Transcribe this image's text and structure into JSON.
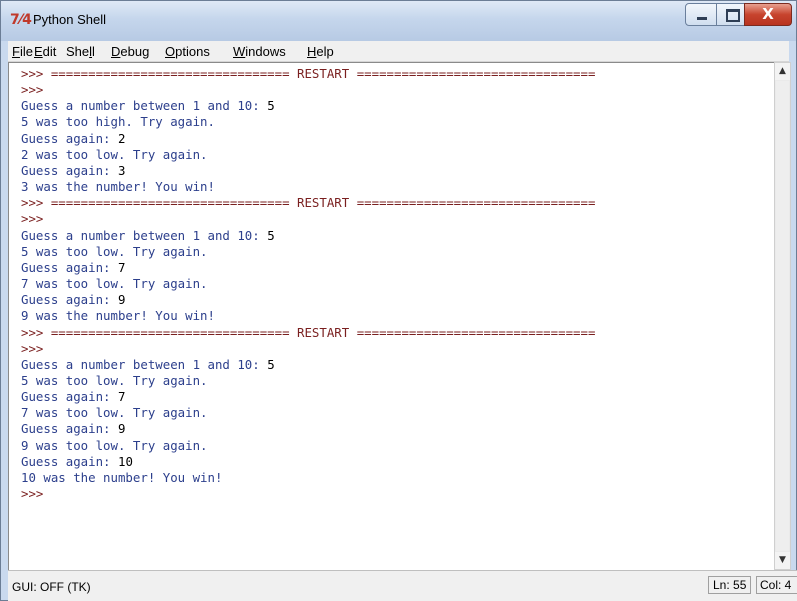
{
  "window": {
    "title": "Python Shell",
    "icon_glyph": "7⁄4",
    "buttons": {
      "close_glyph": "X"
    }
  },
  "menu": {
    "items": [
      {
        "underlined": "F",
        "rest": "ile"
      },
      {
        "underlined": "E",
        "rest": "dit"
      },
      {
        "before": "She",
        "underlined": "l",
        "rest": "l"
      },
      {
        "underlined": "D",
        "rest": "ebug"
      },
      {
        "underlined": "O",
        "rest": "ptions"
      },
      {
        "underlined": "W",
        "rest": "indows"
      },
      {
        "underlined": "H",
        "rest": "elp"
      }
    ]
  },
  "shell": {
    "lines": [
      {
        "kind": "restart",
        "text": ">>> ================================ RESTART ================================"
      },
      {
        "kind": "prompt",
        "text": ">>>"
      },
      {
        "kind": "output",
        "text": "Guess a number between 1 and 10: ",
        "input": "5"
      },
      {
        "kind": "output",
        "text": "5 was too high. Try again."
      },
      {
        "kind": "output",
        "text": "Guess again: ",
        "input": "2"
      },
      {
        "kind": "output",
        "text": "2 was too low. Try again."
      },
      {
        "kind": "output",
        "text": "Guess again: ",
        "input": "3"
      },
      {
        "kind": "output",
        "text": "3 was the number! You win!"
      },
      {
        "kind": "restart",
        "text": ">>> ================================ RESTART ================================"
      },
      {
        "kind": "prompt",
        "text": ">>>"
      },
      {
        "kind": "output",
        "text": "Guess a number between 1 and 10: ",
        "input": "5"
      },
      {
        "kind": "output",
        "text": "5 was too low. Try again."
      },
      {
        "kind": "output",
        "text": "Guess again: ",
        "input": "7"
      },
      {
        "kind": "output",
        "text": "7 was too low. Try again."
      },
      {
        "kind": "output",
        "text": "Guess again: ",
        "input": "9"
      },
      {
        "kind": "output",
        "text": "9 was the number! You win!"
      },
      {
        "kind": "restart",
        "text": ">>> ================================ RESTART ================================"
      },
      {
        "kind": "prompt",
        "text": ">>>"
      },
      {
        "kind": "output",
        "text": "Guess a number between 1 and 10: ",
        "input": "5"
      },
      {
        "kind": "output",
        "text": "5 was too low. Try again."
      },
      {
        "kind": "output",
        "text": "Guess again: ",
        "input": "7"
      },
      {
        "kind": "output",
        "text": "7 was too low. Try again."
      },
      {
        "kind": "output",
        "text": "Guess again: ",
        "input": "9"
      },
      {
        "kind": "output",
        "text": "9 was too low. Try again."
      },
      {
        "kind": "output",
        "text": "Guess again: ",
        "input": "10"
      },
      {
        "kind": "output",
        "text": "10 was the number! You win!"
      },
      {
        "kind": "prompt",
        "text": ">>>"
      }
    ]
  },
  "scrollbar": {
    "up_glyph": "▲",
    "down_glyph": "▼"
  },
  "status": {
    "left": "GUI: OFF (TK)",
    "line": "Ln: 55",
    "col": "Col: 4"
  },
  "colors": {
    "prompt": "#7a1f1f",
    "output": "#2c3f8c",
    "input": "#000000",
    "titlebar": "#c5d6ec",
    "close_button": "#c7442e"
  },
  "icons": [
    "python-idle-icon",
    "minimize-icon",
    "maximize-icon",
    "close-icon",
    "scroll-up-arrow-icon",
    "scroll-down-arrow-icon"
  ]
}
